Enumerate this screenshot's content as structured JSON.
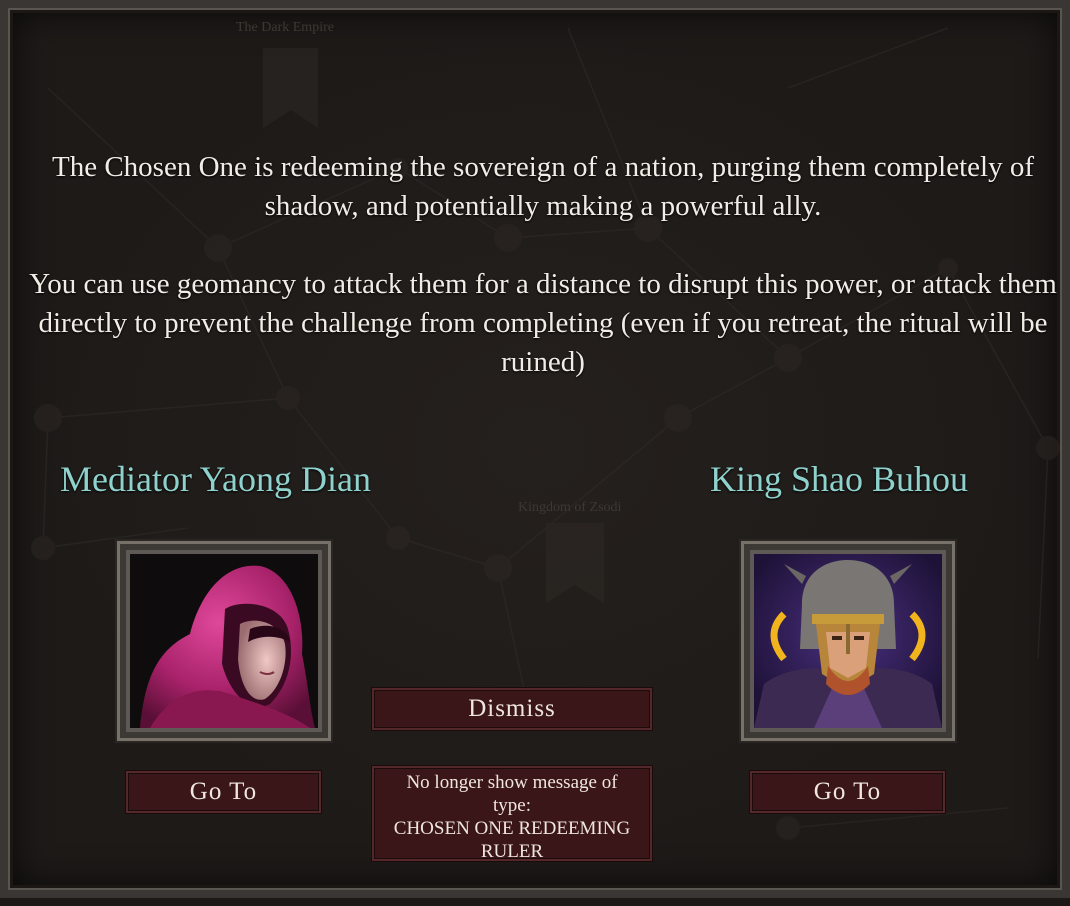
{
  "background": {
    "labels": [
      "The Dark Empire",
      "Kingdom of Zsodi"
    ]
  },
  "message": {
    "paragraph1": "The Chosen One is redeeming the sovereign of a nation, purging them completely of shadow, and potentially making a powerful ally.",
    "paragraph2": "You can use geomancy to attack them for a distance to disrupt this power, or attack them directly to prevent the challenge from completing (even if you retreat, the ritual will be ruined)"
  },
  "left_character": {
    "name": "Mediator Yaong Dian",
    "portrait_icon": "hooded-woman-portrait",
    "goto_label": "Go To"
  },
  "right_character": {
    "name": "King Shao Buhou",
    "portrait_icon": "horned-helmet-king-portrait",
    "goto_label": "Go To"
  },
  "actions": {
    "dismiss_label": "Dismiss",
    "mute_line1": "No longer show message of",
    "mute_line2": "type:",
    "mute_line3": "CHOSEN ONE REDEEMING",
    "mute_line4": "RULER"
  },
  "colors": {
    "name_color": "#8fd2cd",
    "button_bg": "#3a1618",
    "button_border": "#54282a",
    "text": "#f1ece6"
  }
}
